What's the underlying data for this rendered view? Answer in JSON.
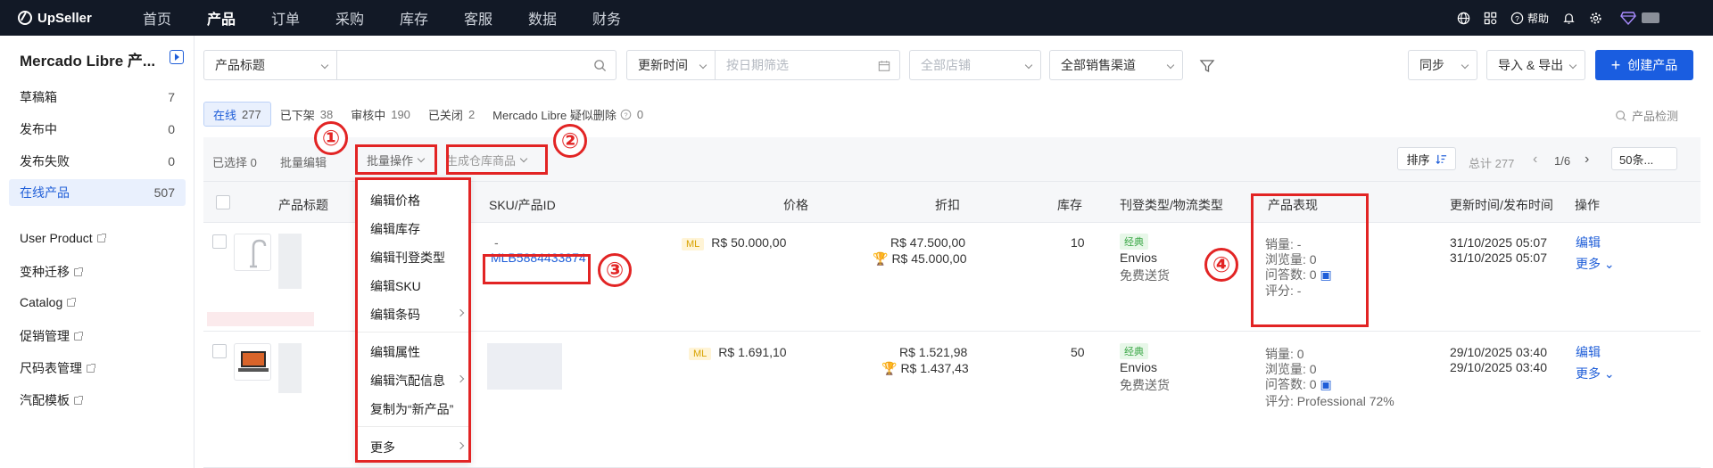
{
  "nav": {
    "brand": "UpSeller",
    "items": [
      "首页",
      "产品",
      "订单",
      "采购",
      "库存",
      "客服",
      "数据",
      "财务"
    ],
    "active_index": 1,
    "help": "帮助"
  },
  "sidebar": {
    "title": "Mercado Libre 产...",
    "items": [
      {
        "label": "草稿箱",
        "count": "7"
      },
      {
        "label": "发布中",
        "count": "0"
      },
      {
        "label": "发布失败",
        "count": "0"
      },
      {
        "label": "在线产品",
        "count": "507"
      }
    ],
    "active_index": 3,
    "links": [
      "User Product",
      "变种迁移",
      "Catalog",
      "促销管理",
      "尺码表管理",
      "汽配模板"
    ]
  },
  "filters": {
    "field_select": "产品标题",
    "search_value": "",
    "time_select": "更新时间",
    "date_placeholder": "按日期筛选",
    "store_placeholder": "全部店铺",
    "channel_select": "全部销售渠道",
    "sync": "同步",
    "import_export": "导入 & 导出",
    "create": "创建产品"
  },
  "tabs": [
    {
      "label": "在线",
      "count": "277"
    },
    {
      "label": "已下架",
      "count": "38"
    },
    {
      "label": "审核中",
      "count": "190"
    },
    {
      "label": "已关闭",
      "count": "2"
    },
    {
      "label": "Mercado Libre 疑似删除",
      "count": "0"
    }
  ],
  "tabs_active_index": 0,
  "product_check": "产品检测",
  "toolbar": {
    "selected": "已选择 0",
    "batch_edit": "批量编辑",
    "batch_ops": "批量操作",
    "gen_warehouse": "生成仓库商品",
    "sort": "排序",
    "total": "总计 277",
    "page": "1/6",
    "per_page": "50条..."
  },
  "annotations": [
    "①",
    "②",
    "③",
    "④"
  ],
  "columns": [
    "产品标题",
    "SKU/产品ID",
    "价格",
    "折扣",
    "库存",
    "刊登类型/物流类型",
    "产品表现",
    "更新时间/发布时间",
    "操作"
  ],
  "dropdown": {
    "items": [
      "编辑价格",
      "编辑库存",
      "编辑刊登类型",
      "编辑SKU",
      "编辑条码",
      "编辑属性",
      "编辑汽配信息",
      "复制为“新产品”",
      "更多"
    ]
  },
  "rows": [
    {
      "sku": "-",
      "product_id": "MLB5884433874",
      "price_tag": "ML",
      "price": "R$ 50.000,00",
      "discount1": "R$ 47.500,00",
      "discount2": "R$ 45.000,00",
      "stock": "10",
      "listing_tag": "经典",
      "shipping": "Envios",
      "shipping_note": "免费送货",
      "perf_sales": "销量: -",
      "perf_views": "浏览量: 0",
      "perf_qa": "问答数: 0",
      "perf_rating": "评分: -",
      "updated": "31/10/2025 05:07",
      "published": "31/10/2025 05:07",
      "edit": "编辑",
      "more": "更多"
    },
    {
      "price_tag": "ML",
      "price": "R$ 1.691,10",
      "discount1": "R$ 1.521,98",
      "discount2": "R$ 1.437,43",
      "stock": "50",
      "listing_tag": "经典",
      "shipping": "Envios",
      "shipping_note": "免费送货",
      "perf_sales": "销量: 0",
      "perf_views": "浏览量: 0",
      "perf_qa": "问答数: 0",
      "perf_rating": "评分: Professional 72%",
      "updated": "29/10/2025 03:40",
      "published": "29/10/2025 03:40",
      "edit": "编辑",
      "more": "更多"
    }
  ],
  "colors": {
    "primary": "#1a5de0",
    "annotation_red": "#e22424",
    "nav_bg": "#121926"
  }
}
